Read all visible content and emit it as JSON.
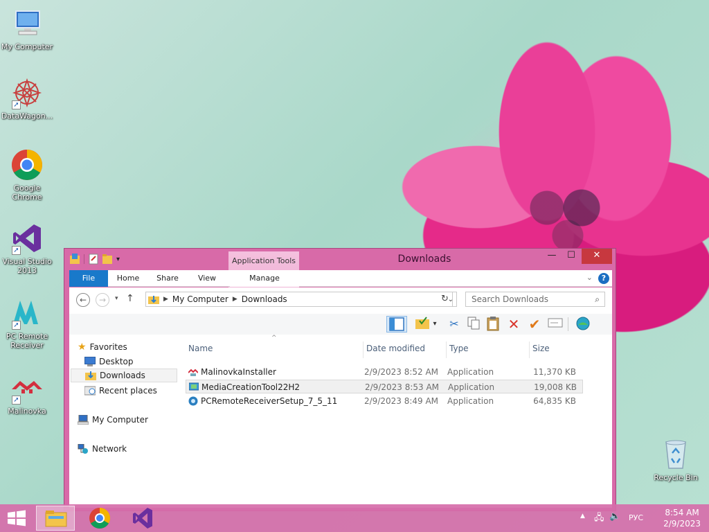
{
  "desktop": {
    "icons": [
      {
        "label": "My Computer"
      },
      {
        "label": "DataWagon..."
      },
      {
        "label": "Google Chrome"
      },
      {
        "label": "Visual Studio 2013"
      },
      {
        "label": "PC Remote Receiver"
      },
      {
        "label": "Malinovka"
      },
      {
        "label": "Recycle Bin"
      }
    ]
  },
  "window": {
    "title": "Downloads",
    "context_tab": "Application Tools",
    "ribbon_tabs": [
      "File",
      "Home",
      "Share",
      "View",
      "Manage"
    ],
    "address": {
      "crumbs": [
        "My Computer",
        "Downloads"
      ]
    },
    "search_placeholder": "Search Downloads",
    "nav": {
      "favorites": "Favorites",
      "desktop": "Desktop",
      "downloads": "Downloads",
      "recent": "Recent places",
      "computer": "My Computer",
      "network": "Network"
    },
    "columns": [
      "Name",
      "Date modified",
      "Type",
      "Size"
    ],
    "files": [
      {
        "name": "MalinovkaInstaller",
        "date": "2/9/2023 8:52 AM",
        "type": "Application",
        "size": "11,370 KB"
      },
      {
        "name": "MediaCreationTool22H2",
        "date": "2/9/2023 8:53 AM",
        "type": "Application",
        "size": "19,008 KB"
      },
      {
        "name": "PCRemoteReceiverSetup_7_5_11",
        "date": "2/9/2023 8:49 AM",
        "type": "Application",
        "size": "64,835 KB"
      }
    ]
  },
  "taskbar": {
    "language": "РУС",
    "time": "8:54 AM",
    "date": "2/9/2023"
  },
  "colors": {
    "accent": "#1979ca",
    "window_frame": "#d86aa8",
    "close_button": "#c7383f"
  }
}
